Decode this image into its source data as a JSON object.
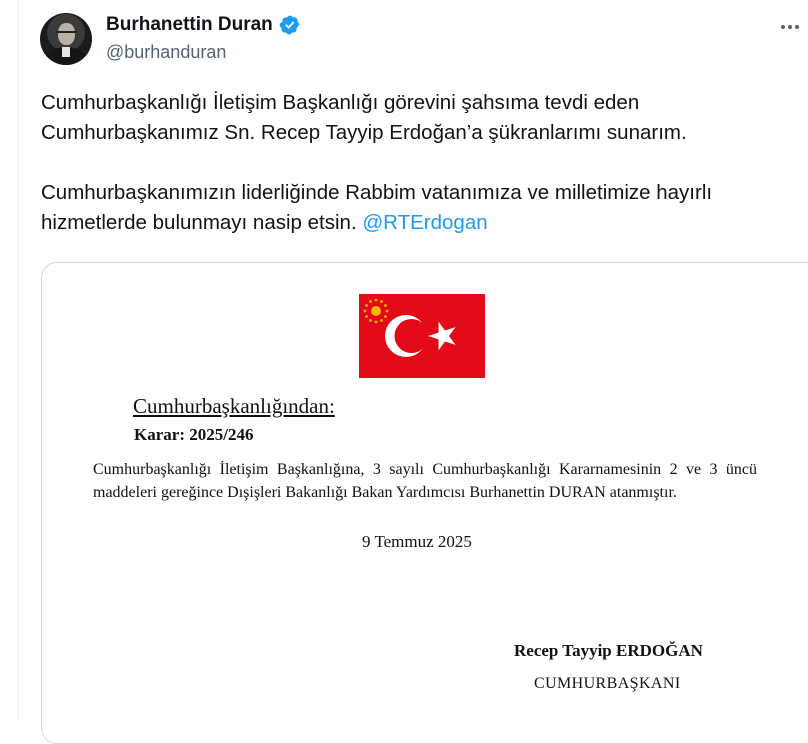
{
  "post": {
    "author": {
      "display_name": "Burhanettin Duran",
      "handle": "@burhanduran",
      "verified": true
    },
    "text_paragraph_1": "Cumhurbaşkanlığı İletişim Başkanlığı görevini şahsıma tevdi eden Cumhurbaşkanımız Sn. Recep Tayyip Erdoğan’a şükranlarımı sunarım.",
    "text_paragraph_2": "Cumhurbaşkanımızın liderliğinde Rabbim vatanımıza ve milletimize hayırlı hizmetlerde bulunmayı nasip etsin.",
    "mention": "@RTErdogan",
    "more_icon": "more-horizontal-icon"
  },
  "document": {
    "heading": "Cumhurbaşkanlığından:",
    "decree": "Karar: 2025/246",
    "body": "Cumhurbaşkanlığı İletişim Başkanlığına, 3 sayılı Cumhurbaşkanlığı Kararnamesinin 2 ve 3 üncü maddeleri gereğince Dışişleri Bakanlığı Bakan Yardımcısı Burhanettin DURAN atanmıştır.",
    "date": "9 Temmuz 2025",
    "signer": "Recep Tayyip ERDOĞAN",
    "signer_title": "CUMHURBAŞKANI",
    "flag_color": "#e30a17",
    "emblem_color": "#f5b800"
  },
  "colors": {
    "link": "#1d9bf0",
    "verified": "#1d9bf0",
    "secondary_text": "#536471",
    "border": "#cfd9de"
  }
}
